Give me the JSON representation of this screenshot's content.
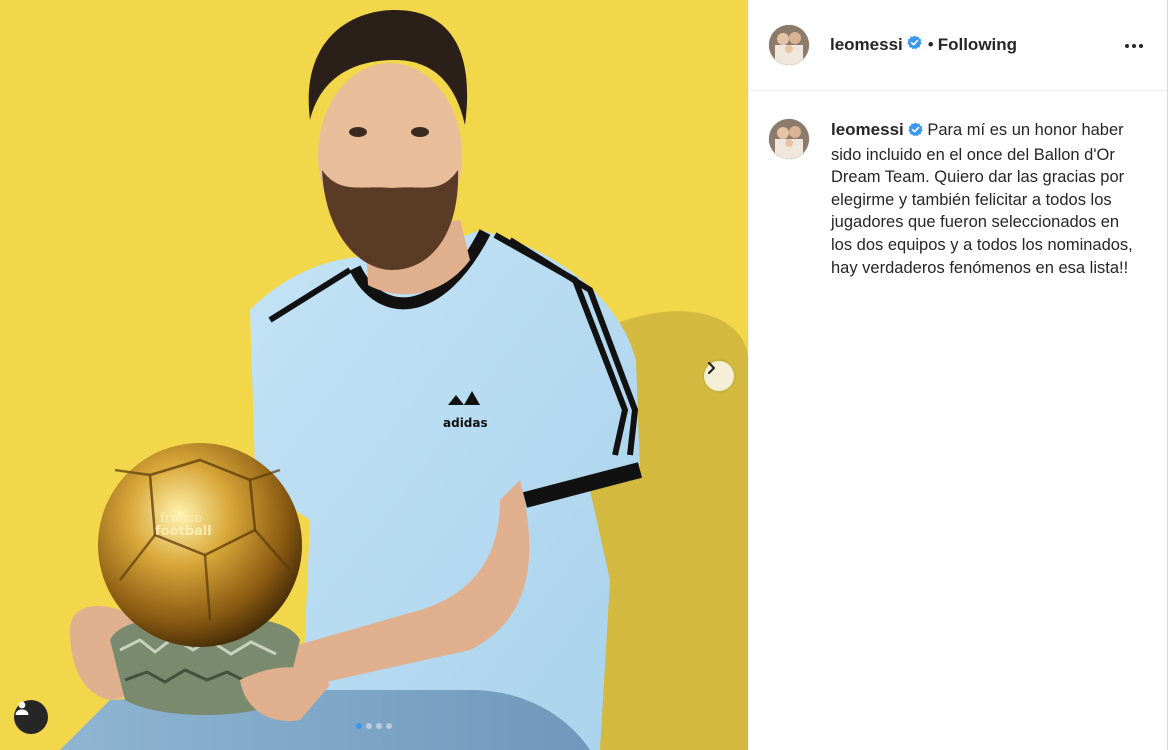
{
  "post": {
    "username": "leomessi",
    "follow_state": "Following",
    "separator": "•",
    "caption": "Para mí es un honor haber sido incluido en el once del Ballon d'Or Dream Team. Quiero dar las gracias por elegirme y también felicitar a todos los jugadores que fueron seleccionados en los dos equipos y a todos los nominados, hay verdaderos fenómenos en esa lista!!",
    "caption_more": "· ··",
    "photo": {
      "shirt_brand": "adidas",
      "trophy_text_1": "france",
      "trophy_text_2": "football",
      "background_color": "#f3d74a"
    },
    "carousel": {
      "slides": 4,
      "active_index": 0
    }
  },
  "colors": {
    "verified": "#3897f0",
    "text": "#262626",
    "border": "#dbdbdb"
  },
  "icons": {
    "verified": "verified-badge-icon",
    "more": "more-options-icon",
    "next": "chevron-right-icon",
    "tag": "user-tag-icon"
  }
}
